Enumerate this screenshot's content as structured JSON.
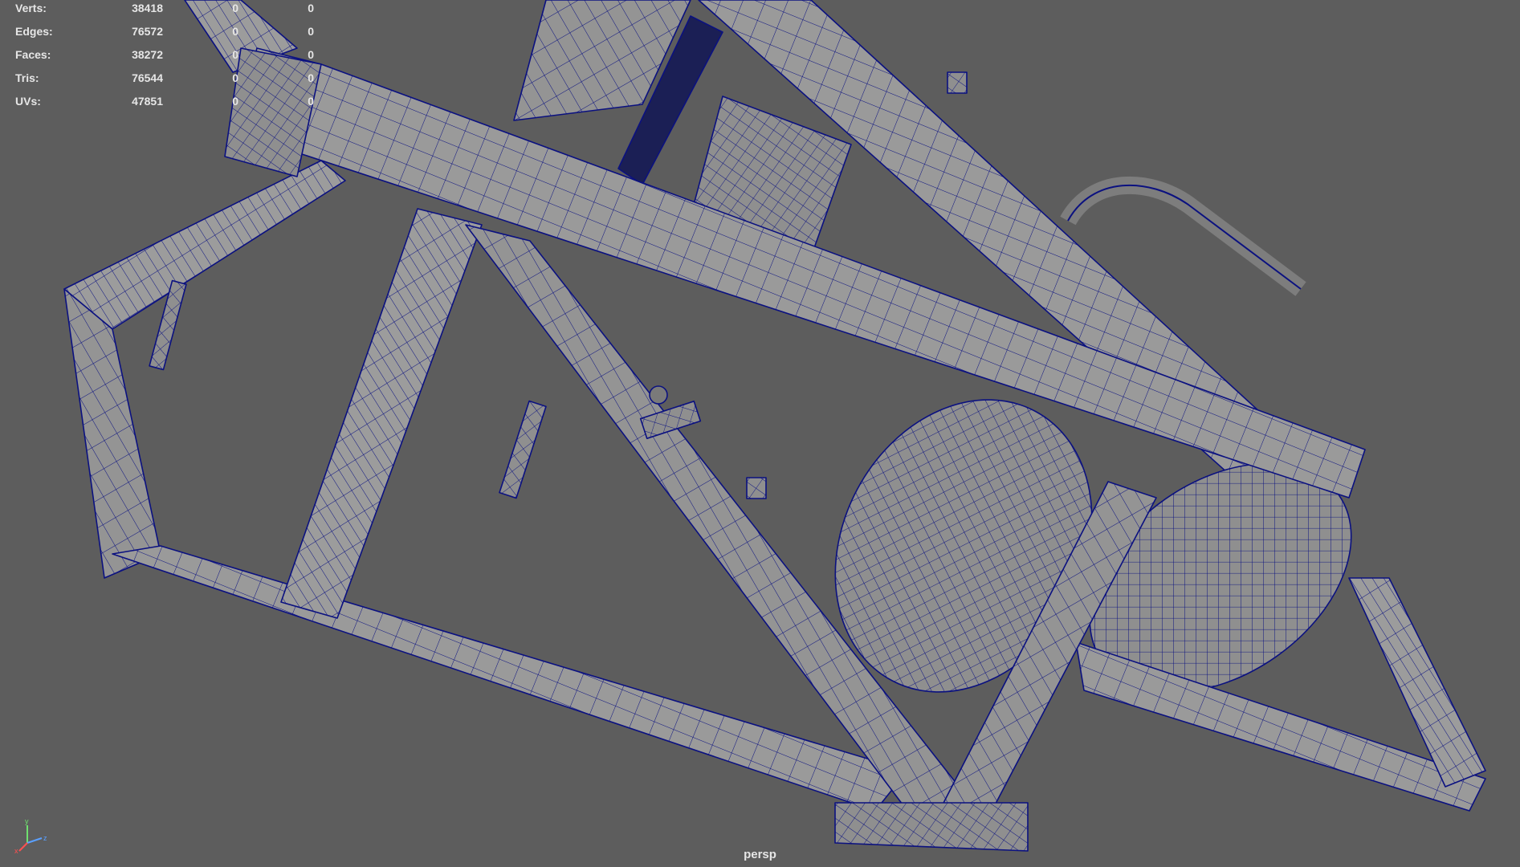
{
  "hud": {
    "rows": [
      {
        "label": "Verts:",
        "value": "38418",
        "selected": "0",
        "uv": "0"
      },
      {
        "label": "Edges:",
        "value": "76572",
        "selected": "0",
        "uv": "0"
      },
      {
        "label": "Faces:",
        "value": "38272",
        "selected": "0",
        "uv": "0"
      },
      {
        "label": "Tris:",
        "value": "76544",
        "selected": "0",
        "uv": "0"
      },
      {
        "label": "UVs:",
        "value": "47851",
        "selected": "0",
        "uv": "0"
      }
    ]
  },
  "viewport": {
    "camera": "persp",
    "background_color": "#5d5d5d",
    "mesh_fill_color": "#9b9b9b",
    "wire_color": "#0b1180"
  },
  "axis_gizmo": {
    "x": "x",
    "y": "y",
    "z": "z"
  }
}
